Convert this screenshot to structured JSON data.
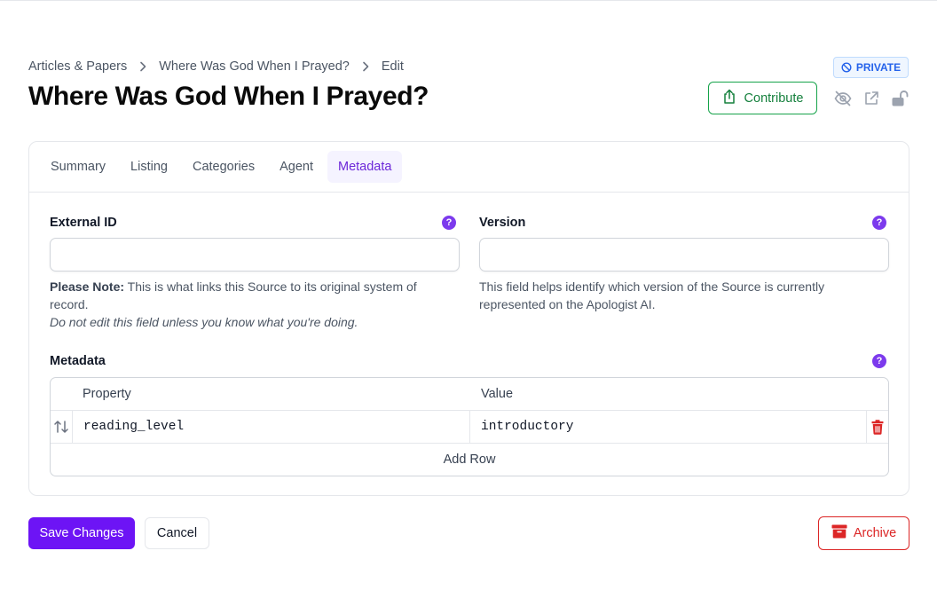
{
  "breadcrumb": {
    "items": [
      "Articles & Papers",
      "Where Was God When I Prayed?",
      "Edit"
    ]
  },
  "page": {
    "title": "Where Was God When I Prayed?",
    "visibility_badge": "PRIVATE"
  },
  "header_actions": {
    "contribute_label": "Contribute",
    "icons": [
      "eye-off-icon",
      "external-link-icon",
      "unlock-icon"
    ]
  },
  "tabs": [
    {
      "label": "Summary",
      "active": false
    },
    {
      "label": "Listing",
      "active": false
    },
    {
      "label": "Categories",
      "active": false
    },
    {
      "label": "Agent",
      "active": false
    },
    {
      "label": "Metadata",
      "active": true
    }
  ],
  "fields": {
    "external_id": {
      "label": "External ID",
      "value": "",
      "note_bold": "Please Note:",
      "note_text": " This is what links this Source to its original system of record.",
      "note_italic": "Do not edit this field unless you know what you're doing."
    },
    "version": {
      "label": "Version",
      "value": "",
      "help_text": "This field helps identify which version of the Source is currently represented on the Apologist AI."
    }
  },
  "metadata": {
    "label": "Metadata",
    "columns": [
      "Property",
      "Value"
    ],
    "rows": [
      {
        "property": "reading_level",
        "value": "introductory"
      }
    ],
    "add_row_label": "Add Row"
  },
  "actions": {
    "save_label": "Save Changes",
    "cancel_label": "Cancel",
    "archive_label": "Archive"
  },
  "colors": {
    "accent": "#6d14f5",
    "active_tab_text": "#6d28d9",
    "success": "#16a34a",
    "danger": "#dc2626",
    "badge": "#2563eb"
  }
}
